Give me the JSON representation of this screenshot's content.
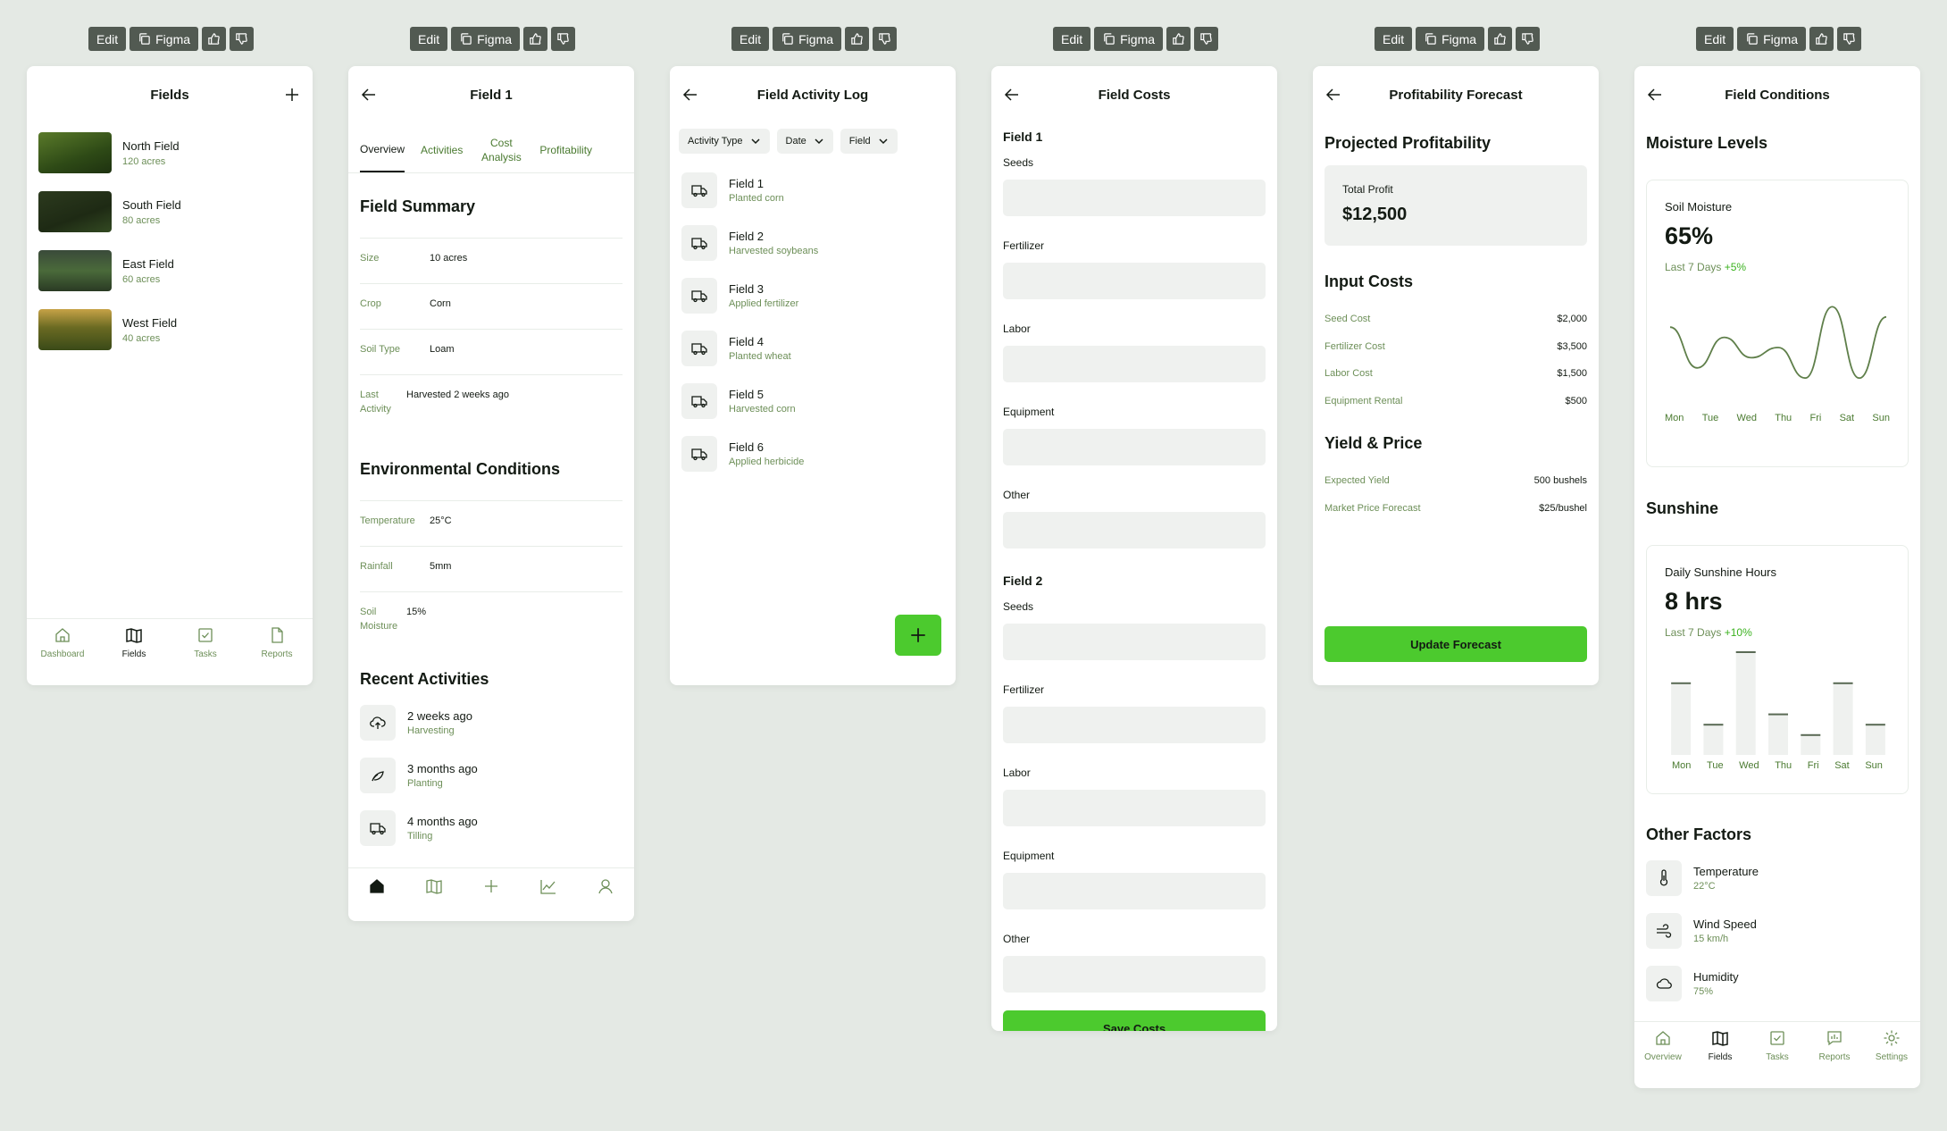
{
  "toolbar": {
    "edit": "Edit",
    "figma": "Figma"
  },
  "colors": {
    "accent": "#4cca2e",
    "muted_green": "#6d8f58",
    "background": "#e4e9e4",
    "positive": "#3bb21f"
  },
  "fields_screen": {
    "title": "Fields",
    "fields": [
      {
        "name": "North Field",
        "area": "120 acres"
      },
      {
        "name": "South Field",
        "area": "80 acres"
      },
      {
        "name": "East Field",
        "area": "60 acres"
      },
      {
        "name": "West Field",
        "area": "40 acres"
      }
    ],
    "nav": [
      "Dashboard",
      "Fields",
      "Tasks",
      "Reports"
    ]
  },
  "field_detail": {
    "title": "Field 1",
    "tabs": [
      "Overview",
      "Activities",
      "Cost Analysis",
      "Profitability"
    ],
    "summary_title": "Field Summary",
    "summary": [
      {
        "k": "Size",
        "v": "10 acres"
      },
      {
        "k": "Crop",
        "v": "Corn"
      },
      {
        "k": "Soil Type",
        "v": "Loam"
      },
      {
        "k": "Last Activity",
        "v": "Harvested 2 weeks ago"
      }
    ],
    "env_title": "Environmental Conditions",
    "env": [
      {
        "k": "Temperature",
        "v": "25°C"
      },
      {
        "k": "Rainfall",
        "v": "5mm"
      },
      {
        "k": "Soil Moisture",
        "v": "15%"
      }
    ],
    "recent_title": "Recent Activities",
    "recent": [
      {
        "when": "2 weeks ago",
        "what": "Harvesting",
        "icon": "cloud-upload-icon"
      },
      {
        "when": "3 months ago",
        "what": "Planting",
        "icon": "plant-icon"
      },
      {
        "when": "4 months ago",
        "what": "Tilling",
        "icon": "truck-icon"
      }
    ]
  },
  "activity_log": {
    "title": "Field Activity Log",
    "filters": [
      "Activity Type",
      "Date",
      "Field"
    ],
    "items": [
      {
        "field": "Field 1",
        "desc": "Planted corn"
      },
      {
        "field": "Field 2",
        "desc": "Harvested soybeans"
      },
      {
        "field": "Field 3",
        "desc": "Applied fertilizer"
      },
      {
        "field": "Field 4",
        "desc": "Planted wheat"
      },
      {
        "field": "Field 5",
        "desc": "Harvested corn"
      },
      {
        "field": "Field 6",
        "desc": "Applied herbicide"
      }
    ]
  },
  "field_costs": {
    "title": "Field Costs",
    "groups": [
      {
        "name": "Field 1",
        "labels": [
          "Seeds",
          "Fertilizer",
          "Labor",
          "Equipment",
          "Other"
        ]
      },
      {
        "name": "Field 2",
        "labels": [
          "Seeds",
          "Fertilizer",
          "Labor",
          "Equipment",
          "Other"
        ]
      }
    ],
    "save": "Save Costs"
  },
  "profit": {
    "title": "Profitability Forecast",
    "projected_title": "Projected Profitability",
    "total_label": "Total Profit",
    "total_value": "$12,500",
    "input_title": "Input Costs",
    "inputs": [
      {
        "k": "Seed Cost",
        "v": "$2,000"
      },
      {
        "k": "Fertilizer Cost",
        "v": "$3,500"
      },
      {
        "k": "Labor Cost",
        "v": "$1,500"
      },
      {
        "k": "Equipment Rental",
        "v": "$500"
      }
    ],
    "yield_title": "Yield & Price",
    "yield": [
      {
        "k": "Expected Yield",
        "v": "500 bushels"
      },
      {
        "k": "Market Price Forecast",
        "v": "$25/bushel"
      }
    ],
    "button": "Update Forecast"
  },
  "conditions": {
    "title": "Field Conditions",
    "moisture_title": "Moisture Levels",
    "moisture_label": "Soil Moisture",
    "moisture_value": "65%",
    "moisture_period": "Last 7 Days",
    "moisture_change": "+5%",
    "sunshine_title": "Sunshine",
    "sun_label": "Daily Sunshine Hours",
    "sun_value": "8 hrs",
    "sun_period": "Last 7 Days",
    "sun_change": "+10%",
    "days": [
      "Mon",
      "Tue",
      "Wed",
      "Thu",
      "Fri",
      "Sat",
      "Sun"
    ],
    "other_title": "Other Factors",
    "factors": [
      {
        "name": "Temperature",
        "value": "22°C"
      },
      {
        "name": "Wind Speed",
        "value": "15 km/h"
      },
      {
        "name": "Humidity",
        "value": "75%"
      }
    ],
    "nav": [
      "Overview",
      "Fields",
      "Tasks",
      "Reports",
      "Settings"
    ]
  },
  "chart_data": [
    {
      "type": "line",
      "title": "Soil Moisture",
      "categories": [
        "Mon",
        "Tue",
        "Wed",
        "Thu",
        "Fri",
        "Sat",
        "Sun"
      ],
      "values": [
        65,
        45,
        60,
        50,
        55,
        40,
        75,
        40,
        70
      ],
      "grid": false
    },
    {
      "type": "bar",
      "title": "Daily Sunshine Hours",
      "categories": [
        "Mon",
        "Tue",
        "Wed",
        "Thu",
        "Fri",
        "Sat",
        "Sun"
      ],
      "values": [
        7,
        3,
        10,
        4,
        2,
        7,
        3
      ],
      "grid": false
    }
  ]
}
